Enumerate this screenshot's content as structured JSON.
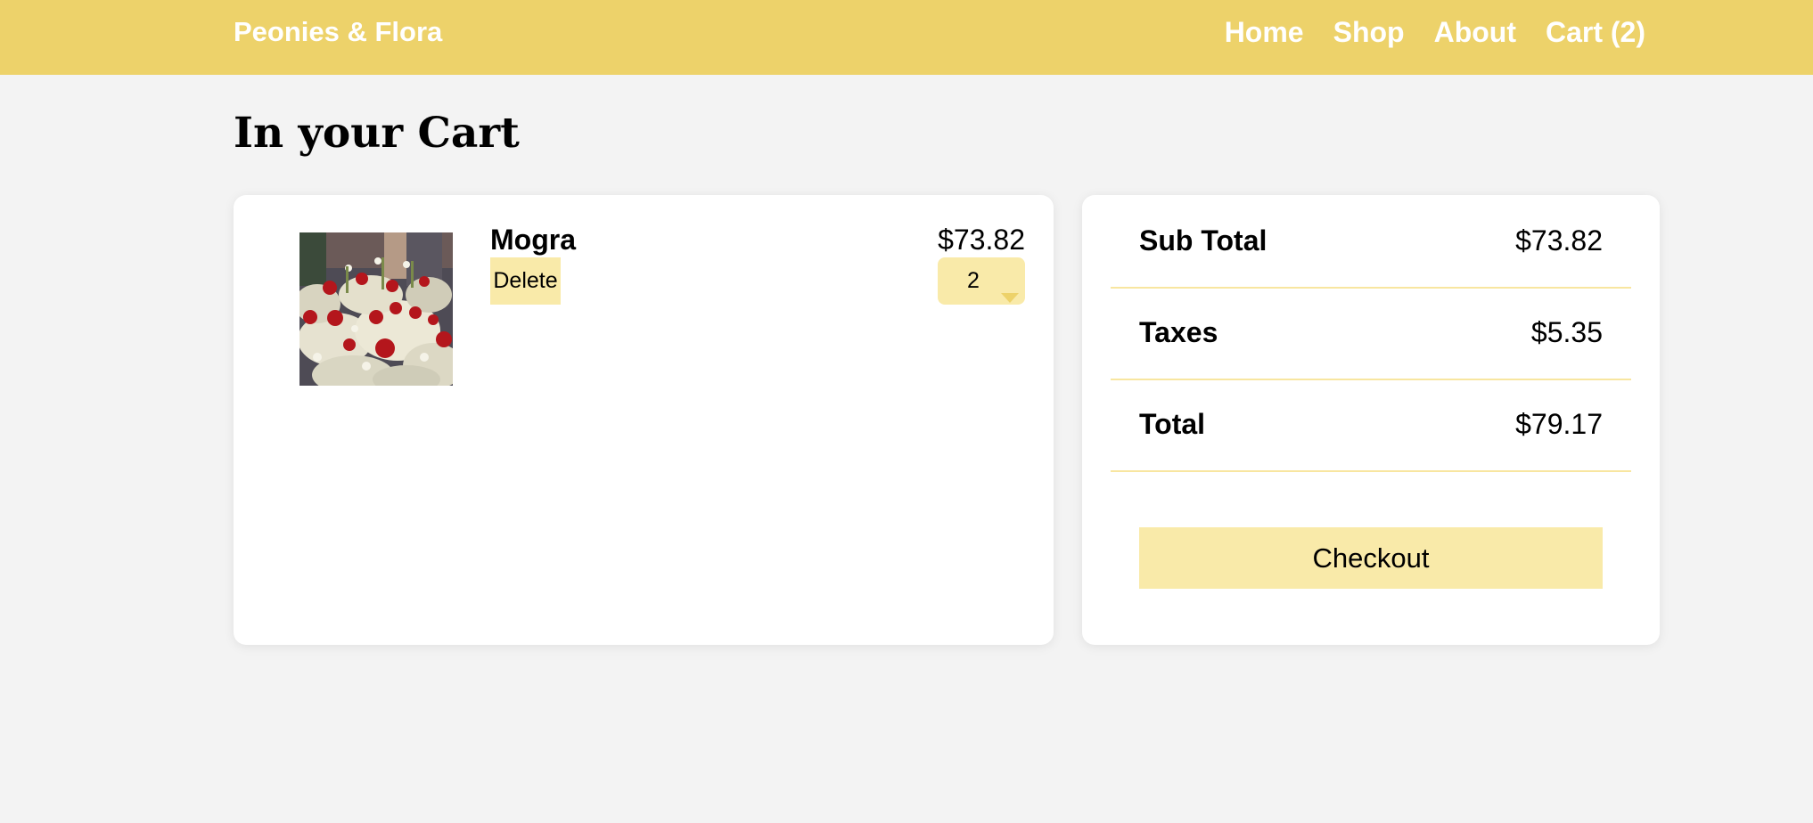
{
  "header": {
    "brand": "Peonies & Flora",
    "nav": [
      "Home",
      "Shop",
      "About",
      "Cart (2)"
    ]
  },
  "page": {
    "title": "In your Cart"
  },
  "cart": {
    "items": [
      {
        "name": "Mogra",
        "price": "$73.82",
        "delete_label": "Delete",
        "quantity": "2",
        "image_alt": "flower arrangement photo"
      }
    ]
  },
  "summary": {
    "rows": [
      {
        "label": "Sub Total",
        "value": "$73.82"
      },
      {
        "label": "Taxes",
        "value": "$5.35"
      },
      {
        "label": "Total",
        "value": "$79.17"
      }
    ],
    "checkout_label": "Checkout"
  },
  "colors": {
    "header": "#edd26a",
    "accent_light": "#f9eaa9",
    "page_background": "#f3f3f3",
    "card": "#ffffff"
  }
}
